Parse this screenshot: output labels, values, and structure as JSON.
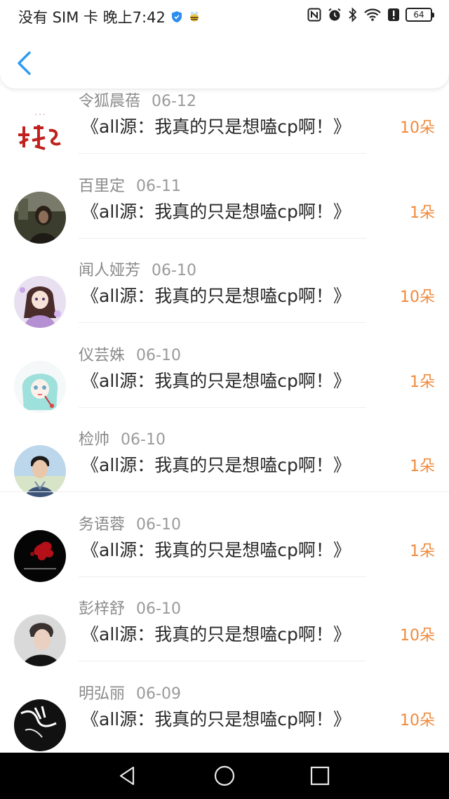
{
  "status_bar": {
    "left_text": "没有 SIM 卡 晚上7:42",
    "battery_level": "64",
    "icons": [
      "shield-icon",
      "bee-icon",
      "nfc-icon",
      "alarm-icon",
      "bluetooth-icon",
      "wifi-icon",
      "alert-icon",
      "battery-icon"
    ]
  },
  "header": {
    "back_icon": "chevron-left-icon",
    "accent_color": "#2d9bf0"
  },
  "colors": {
    "amount": "#f08a3c",
    "name": "#8a8a8a",
    "title": "#2a2a2a"
  },
  "rows": [
    {
      "name": "令狐晨蓓",
      "date": "06-12",
      "title": "《all源：我真的只是想嗑cp啊！》",
      "amount": "10朵",
      "avatar": "calligraphy-avatar"
    },
    {
      "name": "百里定",
      "date": "06-11",
      "title": "《all源：我真的只是想嗑cp啊！》",
      "amount": "1朵",
      "avatar": "portrait-avatar"
    },
    {
      "name": "闻人娅芳",
      "date": "06-10",
      "title": "《all源：我真的只是想嗑cp啊！》",
      "amount": "10朵",
      "avatar": "anime-girl-avatar"
    },
    {
      "name": "仪芸姝",
      "date": "06-10",
      "title": "《all源：我真的只是想嗑cp啊！》",
      "amount": "1朵",
      "avatar": "anime-teal-avatar"
    },
    {
      "name": "检帅",
      "date": "06-10",
      "title": "《all源：我真的只是想嗑cp啊！》",
      "amount": "1朵",
      "avatar": "young-man-avatar"
    },
    {
      "name": "务语蓉",
      "date": "06-10",
      "title": "《all源：我真的只是想嗑cp啊！》",
      "amount": "1朵",
      "avatar": "red-flower-avatar"
    },
    {
      "name": "彭梓舒",
      "date": "06-10",
      "title": "《all源：我真的只是想嗑cp啊！》",
      "amount": "10朵",
      "avatar": "man-portrait-avatar"
    },
    {
      "name": "明弘丽",
      "date": "06-09",
      "title": "《all源：我真的只是想嗑cp啊！》",
      "amount": "10朵",
      "avatar": "hand-sketch-avatar"
    }
  ],
  "nav": {
    "back": "triangle-back-icon",
    "home": "circle-home-icon",
    "recent": "square-recent-icon"
  }
}
